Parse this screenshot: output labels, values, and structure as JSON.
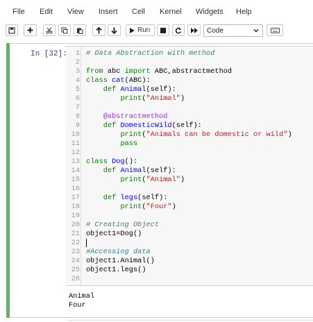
{
  "menu": [
    "File",
    "Edit",
    "View",
    "Insert",
    "Cell",
    "Kernel",
    "Widgets",
    "Help"
  ],
  "toolbar": {
    "buttons": [
      "save-icon",
      "add-cell-icon",
      "cut-icon",
      "copy-icon",
      "paste-icon",
      "move-up-icon",
      "move-down-icon",
      "run-icon",
      "stop-icon",
      "restart-icon",
      "fast-forward-icon"
    ],
    "run_label": "Run",
    "cell_type": "Code",
    "keyboard_icon": "keyboard-icon"
  },
  "cell": {
    "prompt": "In [32]:",
    "lines": [
      {
        "n": "1",
        "parts": [
          {
            "c": "cmt",
            "t": "# Data Abstraction with method"
          }
        ]
      },
      {
        "n": "2",
        "parts": []
      },
      {
        "n": "3",
        "parts": [
          {
            "c": "kw2",
            "t": "from"
          },
          {
            "c": "plain",
            "t": " abc "
          },
          {
            "c": "kw2",
            "t": "import"
          },
          {
            "c": "plain",
            "t": " ABC,abstractmethod"
          }
        ]
      },
      {
        "n": "4",
        "parts": [
          {
            "c": "kw2",
            "t": "class"
          },
          {
            "c": "plain",
            "t": " "
          },
          {
            "c": "def",
            "t": "cat"
          },
          {
            "c": "plain",
            "t": "(ABC):"
          }
        ]
      },
      {
        "n": "5",
        "parts": [
          {
            "c": "plain",
            "t": "    "
          },
          {
            "c": "kw2",
            "t": "def"
          },
          {
            "c": "plain",
            "t": " "
          },
          {
            "c": "def",
            "t": "Animal"
          },
          {
            "c": "plain",
            "t": "(self):"
          }
        ]
      },
      {
        "n": "6",
        "parts": [
          {
            "c": "plain",
            "t": "        "
          },
          {
            "c": "kw2",
            "t": "print"
          },
          {
            "c": "plain",
            "t": "("
          },
          {
            "c": "str",
            "t": "\"Animal\""
          },
          {
            "c": "plain",
            "t": ")"
          }
        ]
      },
      {
        "n": "7",
        "parts": []
      },
      {
        "n": "8",
        "parts": [
          {
            "c": "plain",
            "t": "    "
          },
          {
            "c": "dec",
            "t": "@abstractmethod"
          }
        ]
      },
      {
        "n": "9",
        "parts": [
          {
            "c": "plain",
            "t": "    "
          },
          {
            "c": "kw2",
            "t": "def"
          },
          {
            "c": "plain",
            "t": " "
          },
          {
            "c": "def",
            "t": "DomesticWild"
          },
          {
            "c": "plain",
            "t": "(self):"
          }
        ]
      },
      {
        "n": "10",
        "parts": [
          {
            "c": "plain",
            "t": "        "
          },
          {
            "c": "kw2",
            "t": "print"
          },
          {
            "c": "plain",
            "t": "("
          },
          {
            "c": "str",
            "t": "\"Animals can be domestic or wild\""
          },
          {
            "c": "plain",
            "t": ")"
          }
        ]
      },
      {
        "n": "11",
        "parts": [
          {
            "c": "plain",
            "t": "        "
          },
          {
            "c": "kw2",
            "t": "pass"
          }
        ]
      },
      {
        "n": "12",
        "parts": []
      },
      {
        "n": "13",
        "parts": [
          {
            "c": "kw2",
            "t": "class"
          },
          {
            "c": "plain",
            "t": " "
          },
          {
            "c": "def",
            "t": "Dog"
          },
          {
            "c": "plain",
            "t": "():"
          }
        ]
      },
      {
        "n": "14",
        "parts": [
          {
            "c": "plain",
            "t": "    "
          },
          {
            "c": "kw2",
            "t": "def"
          },
          {
            "c": "plain",
            "t": " "
          },
          {
            "c": "def",
            "t": "Animal"
          },
          {
            "c": "plain",
            "t": "(self):"
          }
        ]
      },
      {
        "n": "15",
        "parts": [
          {
            "c": "plain",
            "t": "        "
          },
          {
            "c": "kw2",
            "t": "print"
          },
          {
            "c": "plain",
            "t": "("
          },
          {
            "c": "str",
            "t": "\"Animal\""
          },
          {
            "c": "plain",
            "t": ")"
          }
        ]
      },
      {
        "n": "16",
        "parts": []
      },
      {
        "n": "17",
        "parts": [
          {
            "c": "plain",
            "t": "    "
          },
          {
            "c": "kw2",
            "t": "def"
          },
          {
            "c": "plain",
            "t": " "
          },
          {
            "c": "def",
            "t": "legs"
          },
          {
            "c": "plain",
            "t": "(self):"
          }
        ]
      },
      {
        "n": "18",
        "parts": [
          {
            "c": "plain",
            "t": "        "
          },
          {
            "c": "kw2",
            "t": "print"
          },
          {
            "c": "plain",
            "t": "("
          },
          {
            "c": "str",
            "t": "\"Four\""
          },
          {
            "c": "plain",
            "t": ")"
          }
        ]
      },
      {
        "n": "19",
        "parts": []
      },
      {
        "n": "20",
        "parts": [
          {
            "c": "cmt",
            "t": "# Creating Object"
          }
        ]
      },
      {
        "n": "21",
        "parts": [
          {
            "c": "plain",
            "t": "object1=Dog()"
          }
        ]
      },
      {
        "n": "22",
        "parts": []
      },
      {
        "n": "23",
        "parts": [
          {
            "c": "cmt",
            "t": "#Accessing data"
          }
        ]
      },
      {
        "n": "24",
        "parts": [
          {
            "c": "plain",
            "t": "object1.Animal()"
          }
        ]
      },
      {
        "n": "25",
        "parts": [
          {
            "c": "plain",
            "t": "object1.legs()"
          }
        ]
      },
      {
        "n": "26",
        "parts": []
      }
    ],
    "output": [
      "Animal",
      "Four"
    ]
  },
  "colors": {
    "accent_bar": "#5cb85c",
    "prompt": "#303f9f"
  }
}
